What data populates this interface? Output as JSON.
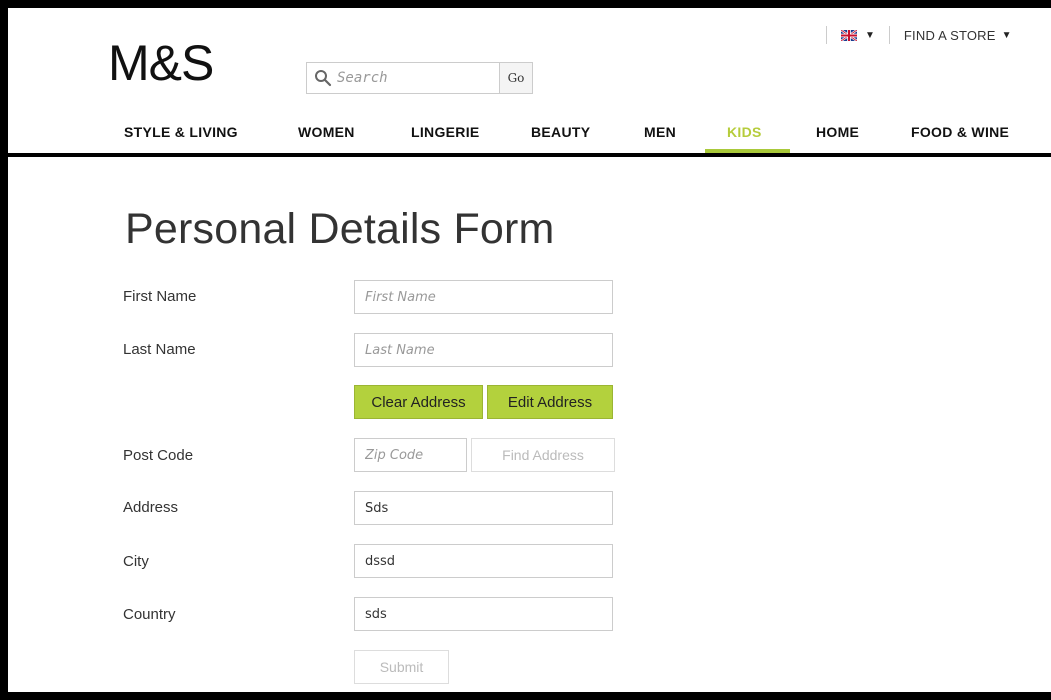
{
  "header": {
    "logo": "M&S",
    "search": {
      "placeholder": "Search",
      "go_label": "Go"
    },
    "utility": {
      "flag_icon": "uk-flag-icon",
      "find_store": "FIND A STORE"
    },
    "nav": [
      {
        "label": "STYLE & LIVING",
        "active": false
      },
      {
        "label": "WOMEN",
        "active": false
      },
      {
        "label": "LINGERIE",
        "active": false
      },
      {
        "label": "BEAUTY",
        "active": false
      },
      {
        "label": "MEN",
        "active": false
      },
      {
        "label": "KIDS",
        "active": true
      },
      {
        "label": "HOME",
        "active": false
      },
      {
        "label": "FOOD & WINE",
        "active": false
      }
    ]
  },
  "form": {
    "title": "Personal Details Form",
    "first_name": {
      "label": "First Name",
      "placeholder": "First Name",
      "value": ""
    },
    "last_name": {
      "label": "Last Name",
      "placeholder": "Last Name",
      "value": ""
    },
    "clear_address": "Clear Address",
    "edit_address": "Edit Address",
    "post_code": {
      "label": "Post Code",
      "placeholder": "Zip Code",
      "value": ""
    },
    "find_address": "Find Address",
    "address": {
      "label": "Address",
      "value": "Sds"
    },
    "city": {
      "label": "City",
      "value": "dssd"
    },
    "country": {
      "label": "Country",
      "value": "sds"
    },
    "submit": "Submit"
  },
  "colors": {
    "accent_green": "#b3d13d",
    "active_nav": "#b6cc3b",
    "frame": "#000000"
  }
}
